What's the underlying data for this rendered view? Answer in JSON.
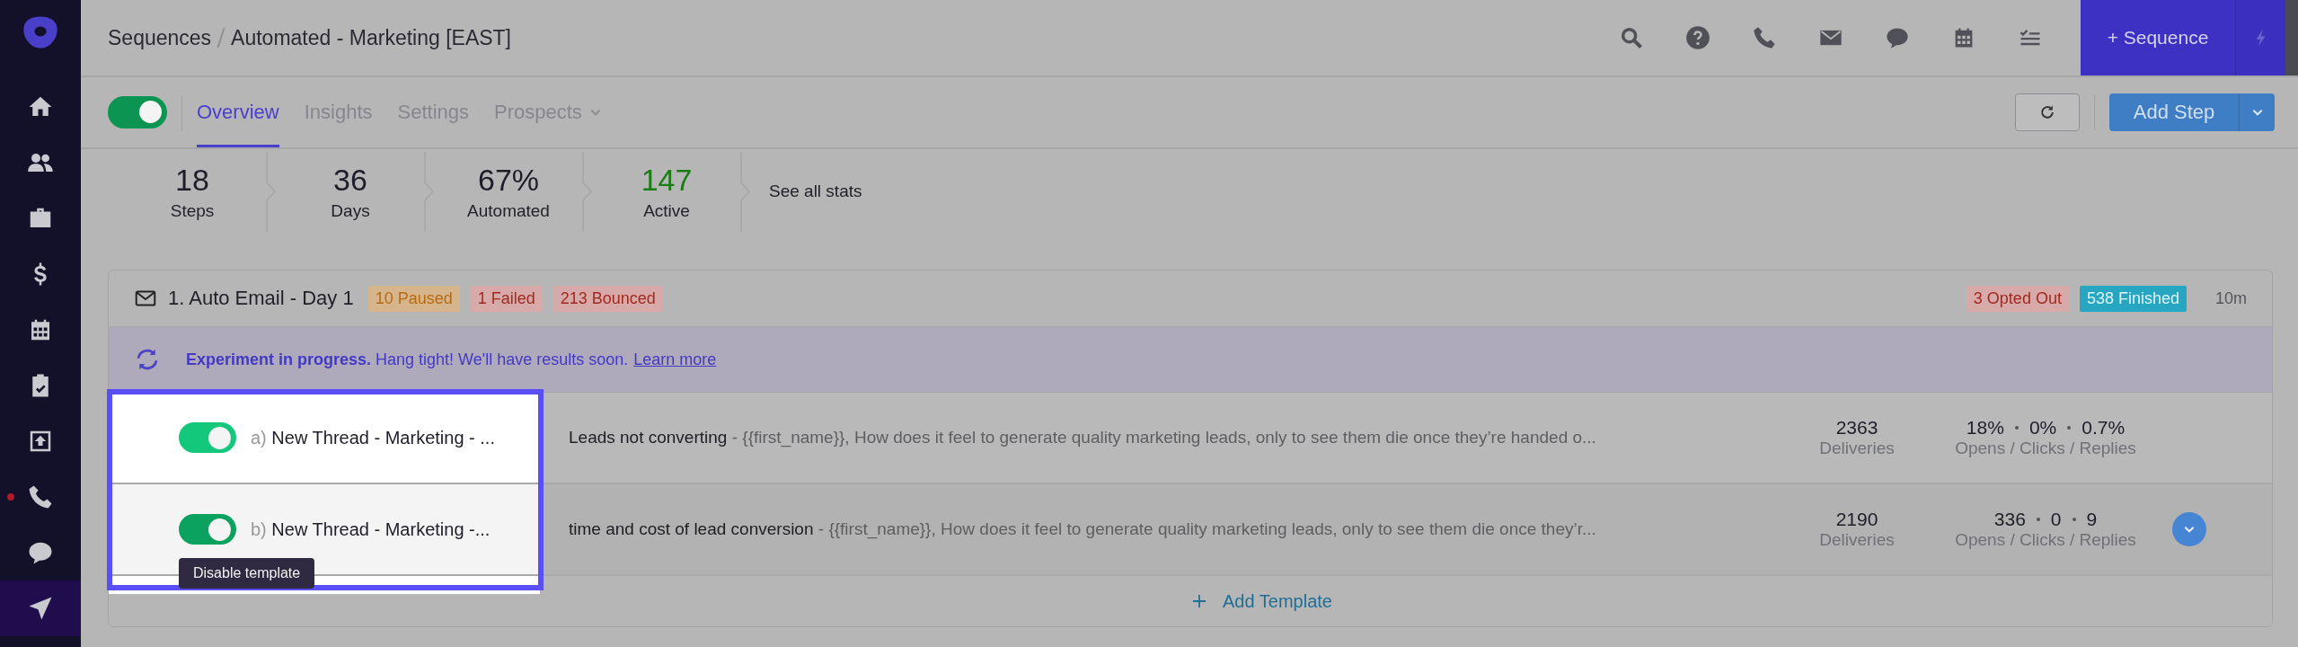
{
  "sidebar": {
    "items": [
      {
        "selected": false,
        "notification": false
      },
      {
        "selected": false,
        "notification": false
      },
      {
        "selected": false,
        "notification": false
      },
      {
        "selected": false,
        "notification": false
      },
      {
        "selected": false,
        "notification": false
      },
      {
        "selected": false,
        "notification": false
      },
      {
        "selected": false,
        "notification": false
      },
      {
        "selected": false,
        "notification": true
      },
      {
        "selected": false,
        "notification": false
      },
      {
        "selected": true,
        "notification": false
      }
    ]
  },
  "breadcrumb": [
    "Sequences",
    "Automated - Marketing [EAST]"
  ],
  "primary_button": "+ Sequence",
  "sequence_enabled": true,
  "tabs": [
    {
      "label": "Overview",
      "selected": true,
      "dropdown": false
    },
    {
      "label": "Insights",
      "selected": false,
      "dropdown": false
    },
    {
      "label": "Settings",
      "selected": false,
      "dropdown": false
    },
    {
      "label": "Prospects",
      "selected": false,
      "dropdown": true
    }
  ],
  "add_step_button": "Add Step",
  "stats": [
    {
      "value": "18",
      "label": "Steps",
      "positive": false
    },
    {
      "value": "36",
      "label": "Days",
      "positive": false
    },
    {
      "value": "67%",
      "label": "Automated",
      "positive": false
    },
    {
      "value": "147",
      "label": "Active",
      "positive": true
    }
  ],
  "see_all_stats": "See all stats",
  "step": {
    "title": "1. Auto Email - Day 1",
    "badges": [
      {
        "text": "10 Paused",
        "color": "#d6b58c"
      },
      {
        "text": "1 Failed",
        "color": "#d8a9a9"
      },
      {
        "text": "213 Bounced",
        "color": "#d8a9a9"
      }
    ],
    "right_badges": [
      {
        "text": "3 Opted Out",
        "color": "#d8a9a9"
      },
      {
        "text": "538 Finished",
        "color": "#27a6c2"
      }
    ],
    "duration": "10m",
    "banner": "**Experiment in progress.** Hang tight! We'll have results soon.",
    "banner_link": "Learn more",
    "templates": [
      {
        "label": "a)",
        "name": "New Thread - Marketing - ...",
        "enabled": true,
        "subject": "Leads not converting",
        "preview": " - {{first_name}}, How does it feel to generate quality marketing leads, only to see them die once they’re handed o...",
        "deliveries": "2363",
        "deliveries_label": "Deliveries",
        "opens": "18%",
        "clicks": "0%",
        "replies": "0.7%",
        "rates_label": "Opens / Clicks / Replies",
        "expand": false
      },
      {
        "label": "b)",
        "name": "New Thread - Marketing -...",
        "enabled": true,
        "subject": "time and cost of lead conversion",
        "preview": " - {{first_name}}, How does it feel to generate quality marketing leads, only to see them die once they’r...",
        "deliveries": "2190",
        "deliveries_label": "Deliveries",
        "opens": "336",
        "clicks": "0",
        "replies": "9",
        "rates_label": "Opens / Clicks / Replies",
        "expand": true
      }
    ],
    "add_template": "Add Template"
  },
  "tooltip": "Disable template"
}
